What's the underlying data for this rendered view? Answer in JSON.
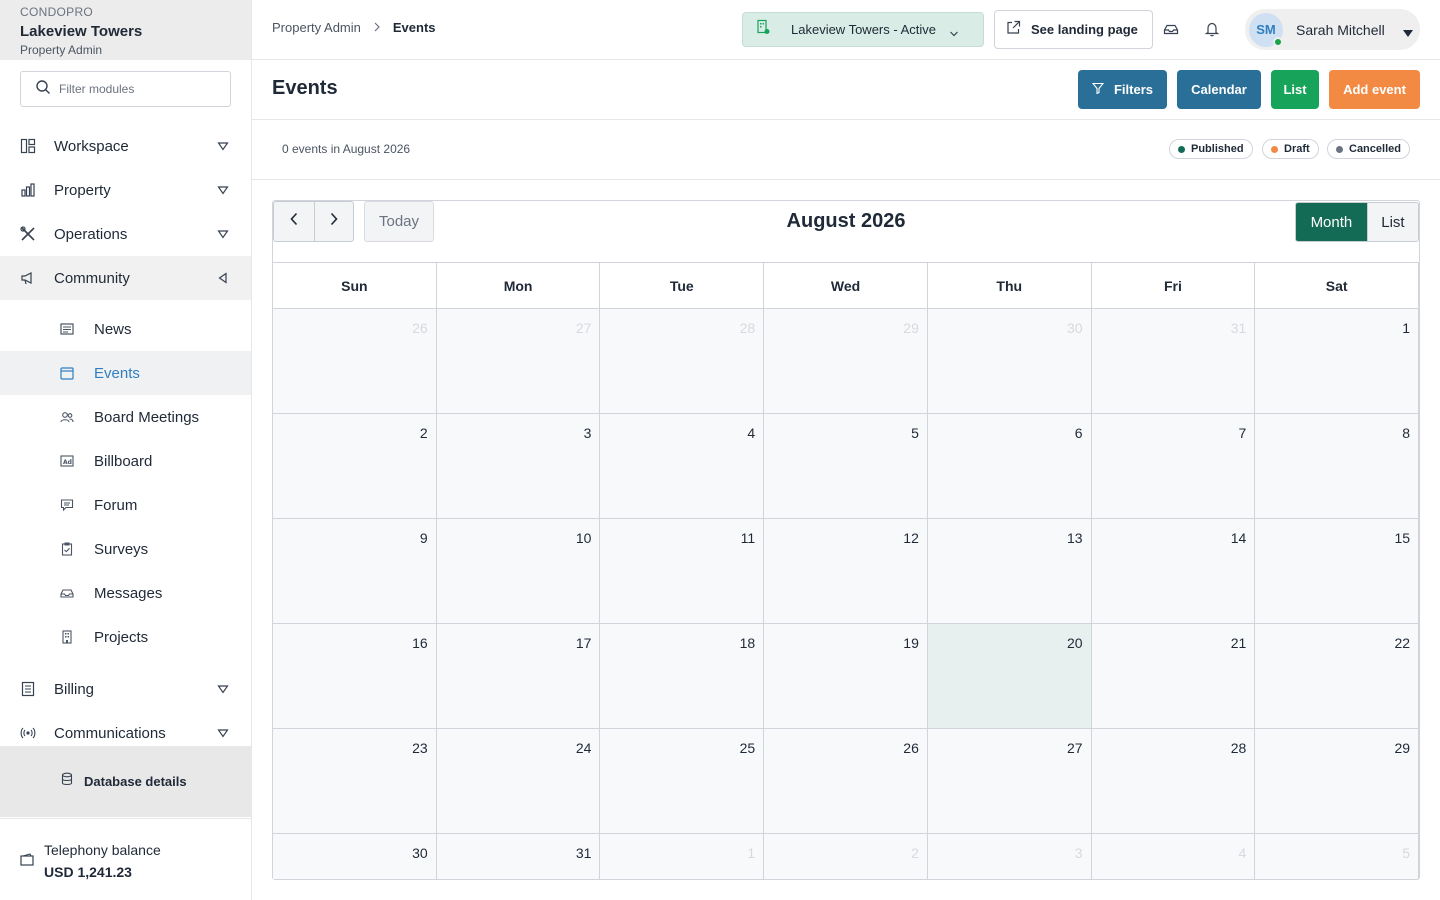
{
  "sidebar": {
    "org": "CONDOPRO",
    "property_name": "Lakeview Towers",
    "role": "Property Admin",
    "filter_placeholder": "Filter modules",
    "groups_top": [
      {
        "label": "Workspace",
        "icon": "layout-icon"
      },
      {
        "label": "Property",
        "icon": "building-chart-icon"
      },
      {
        "label": "Operations",
        "icon": "tools-icon"
      },
      {
        "label": "Community",
        "icon": "megaphone-icon"
      }
    ],
    "community_items": [
      {
        "label": "News",
        "icon": "newspaper-icon"
      },
      {
        "label": "Events",
        "icon": "calendar-icon",
        "active": true
      },
      {
        "label": "Board Meetings",
        "icon": "users-icon"
      },
      {
        "label": "Billboard",
        "icon": "ad-icon"
      },
      {
        "label": "Forum",
        "icon": "chat-icon"
      },
      {
        "label": "Surveys",
        "icon": "clipboard-icon"
      },
      {
        "label": "Messages",
        "icon": "inbox-icon"
      },
      {
        "label": "Projects",
        "icon": "building-icon"
      }
    ],
    "groups_bottom": [
      {
        "label": "Billing",
        "icon": "receipt-icon"
      },
      {
        "label": "Communications",
        "icon": "broadcast-icon"
      }
    ],
    "database_details": "Database details",
    "telephony": {
      "label": "Telephony balance",
      "value": "USD 1,241.23"
    }
  },
  "topbar": {
    "breadcrumb_root": "Property Admin",
    "breadcrumb_current": "Events",
    "property_selector": "Lakeview Towers - Active",
    "landing_button": "See landing page",
    "user": {
      "initials": "SM",
      "name": "Sarah Mitchell"
    }
  },
  "header": {
    "title": "Events",
    "buttons": {
      "filters": "Filters",
      "calendar": "Calendar",
      "list": "List",
      "add": "Add event"
    }
  },
  "summary": {
    "count_text": "0 events in August 2026",
    "legend": [
      {
        "label": "Published",
        "color": "#136a55"
      },
      {
        "label": "Draft",
        "color": "#f28a44"
      },
      {
        "label": "Cancelled",
        "color": "#6b7280"
      }
    ]
  },
  "calendar": {
    "today_label": "Today",
    "title": "August 2026",
    "view_month": "Month",
    "view_list": "List",
    "days_of_week": [
      "Sun",
      "Mon",
      "Tue",
      "Wed",
      "Thu",
      "Fri",
      "Sat"
    ],
    "today_date": "20",
    "weeks": [
      [
        {
          "d": "26",
          "o": true
        },
        {
          "d": "27",
          "o": true
        },
        {
          "d": "28",
          "o": true
        },
        {
          "d": "29",
          "o": true
        },
        {
          "d": "30",
          "o": true
        },
        {
          "d": "31",
          "o": true
        },
        {
          "d": "1"
        }
      ],
      [
        {
          "d": "2"
        },
        {
          "d": "3"
        },
        {
          "d": "4"
        },
        {
          "d": "5"
        },
        {
          "d": "6"
        },
        {
          "d": "7"
        },
        {
          "d": "8"
        }
      ],
      [
        {
          "d": "9"
        },
        {
          "d": "10"
        },
        {
          "d": "11"
        },
        {
          "d": "12"
        },
        {
          "d": "13"
        },
        {
          "d": "14"
        },
        {
          "d": "15"
        }
      ],
      [
        {
          "d": "16"
        },
        {
          "d": "17"
        },
        {
          "d": "18"
        },
        {
          "d": "19"
        },
        {
          "d": "20"
        },
        {
          "d": "21"
        },
        {
          "d": "22"
        }
      ],
      [
        {
          "d": "23"
        },
        {
          "d": "24"
        },
        {
          "d": "25"
        },
        {
          "d": "26"
        },
        {
          "d": "27"
        },
        {
          "d": "28"
        },
        {
          "d": "29"
        }
      ],
      [
        {
          "d": "30"
        },
        {
          "d": "31"
        },
        {
          "d": "1",
          "o": true
        },
        {
          "d": "2",
          "o": true
        },
        {
          "d": "3",
          "o": true
        },
        {
          "d": "4",
          "o": true
        },
        {
          "d": "5",
          "o": true
        }
      ]
    ]
  }
}
